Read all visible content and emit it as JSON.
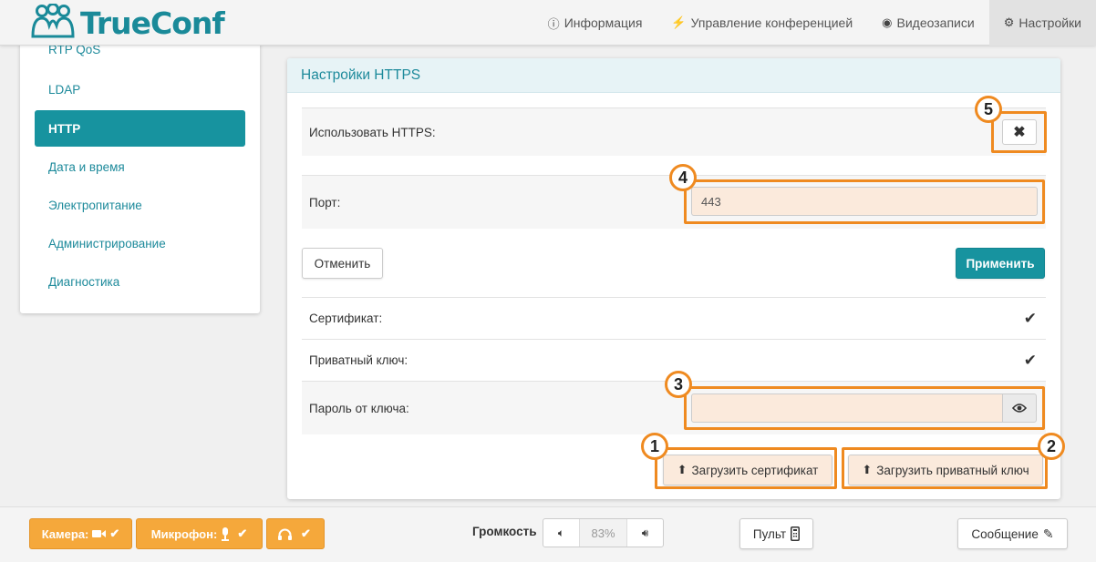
{
  "header": {
    "logo_text": "TrueConf",
    "nav": [
      {
        "label": "Информация",
        "icon": "info-circle-icon"
      },
      {
        "label": "Управление конференцией",
        "icon": "lightning-icon"
      },
      {
        "label": "Видеозаписи",
        "icon": "record-circle-icon"
      },
      {
        "label": "Настройки",
        "icon": "gear-icon"
      }
    ],
    "active_nav": "Настройки"
  },
  "sidebar": {
    "items": [
      {
        "label": "RTP QoS"
      },
      {
        "label": "LDAP"
      },
      {
        "label": "HTTP"
      },
      {
        "label": "Дата и время"
      },
      {
        "label": "Электропитание"
      },
      {
        "label": "Администрирование"
      },
      {
        "label": "Диагностика"
      }
    ],
    "active": "HTTP"
  },
  "panel": {
    "title": "Настройки HTTPS",
    "use_https_label": "Использовать HTTPS:",
    "use_https_icon": "close-x-icon",
    "port_label": "Порт:",
    "port_value": "443",
    "cancel_label": "Отменить",
    "apply_label": "Применить",
    "certificate_label": "Сертификат:",
    "private_key_label": "Приватный ключ:",
    "key_password_label": "Пароль от ключа:",
    "key_password_value": "",
    "upload_cert_label": "Загрузить сертификат",
    "upload_key_label": "Загрузить приватный ключ"
  },
  "annotations": [
    "1",
    "2",
    "3",
    "4",
    "5"
  ],
  "footer": {
    "camera_label": "Камера:",
    "mic_label": "Микрофон:",
    "volume_label": "Громкость",
    "volume_value": "83%",
    "remote_label": "Пульт",
    "message_label": "Сообщение"
  },
  "colors": {
    "accent": "#17939f",
    "highlight": "#ef8a20",
    "footer_buttons": "#f5a83b"
  }
}
